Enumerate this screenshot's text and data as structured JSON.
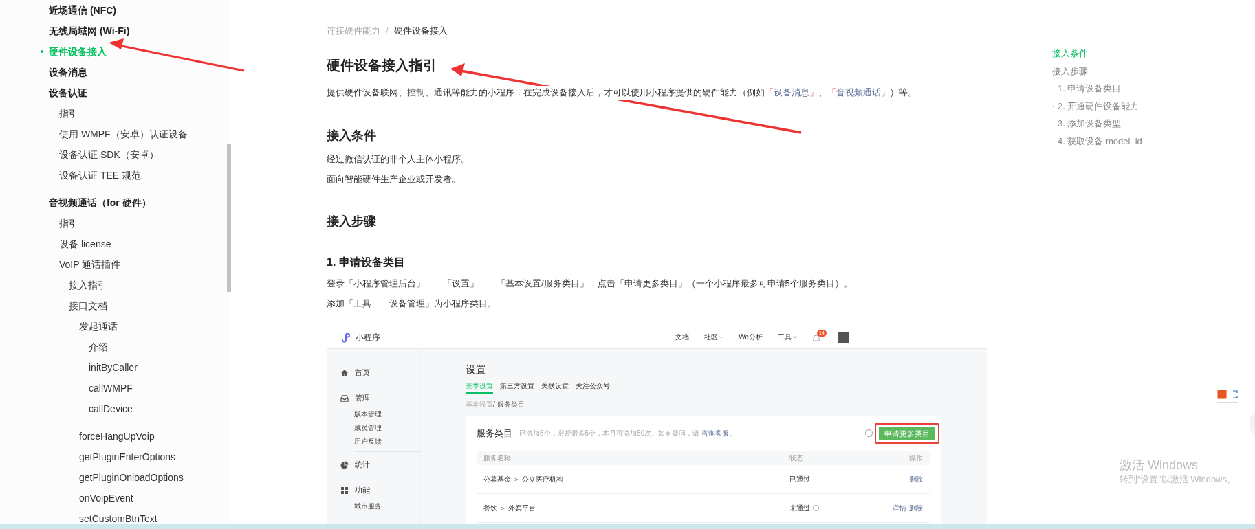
{
  "sidebar": {
    "items": [
      {
        "label": "近场通信 (NFC)",
        "selected": false
      },
      {
        "label": "无线局域网 (Wi-Fi)",
        "selected": false
      },
      {
        "label": "硬件设备接入",
        "selected": true
      },
      {
        "label": "设备消息",
        "selected": false
      },
      {
        "label": "设备认证",
        "selected": false,
        "children": [
          {
            "label": "指引",
            "selected": false
          },
          {
            "label": "使用 WMPF（安卓）认证设备",
            "selected": false
          },
          {
            "label": "设备认证 SDK（安卓）",
            "selected": false
          },
          {
            "label": "设备认证 TEE 规范",
            "selected": false
          }
        ]
      },
      {
        "label": "音视频通话（for 硬件）",
        "selected": false,
        "children": [
          {
            "label": "指引",
            "selected": false
          },
          {
            "label": "设备 license",
            "selected": false
          },
          {
            "label": "VoIP 通话插件",
            "selected": false,
            "children": [
              {
                "label": "接入指引",
                "selected": false
              },
              {
                "label": "接口文档",
                "selected": false,
                "children": [
                  {
                    "label": "发起通话",
                    "selected": false,
                    "children": [
                      {
                        "label": "介绍",
                        "selected": false
                      },
                      {
                        "label": "initByCaller",
                        "selected": false
                      },
                      {
                        "label": "callWMPF",
                        "selected": false
                      },
                      {
                        "label": "callDevice",
                        "selected": false
                      }
                    ]
                  },
                  {
                    "label": "forceHangUpVoip",
                    "selected": false
                  },
                  {
                    "label": "getPluginEnterOptions",
                    "selected": false
                  },
                  {
                    "label": "getPluginOnloadOptions",
                    "selected": false
                  },
                  {
                    "label": "onVoipEvent",
                    "selected": false
                  },
                  {
                    "label": "setCustomBtnText",
                    "selected": false
                  }
                ]
              }
            ]
          }
        ]
      }
    ]
  },
  "breadcrumb": [
    {
      "label": "连接硬件能力",
      "current": false
    },
    {
      "label": "硬件设备接入",
      "current": true
    }
  ],
  "breadcrumb_separator": "/",
  "title": "硬件设备接入指引",
  "intro": [
    {
      "text": "提供硬件设备联网、控制、通讯等能力的小程序，在完成设备接入后，才可以使用小程序提供的硬件能力（例如"
    },
    {
      "text": "「",
      "kind": "bracket"
    },
    {
      "text": "设备消息",
      "kind": "link"
    },
    {
      "text": "」",
      "kind": "bracket"
    },
    {
      "text": "、"
    },
    {
      "text": "「",
      "kind": "bracket"
    },
    {
      "text": "音视频通话",
      "kind": "link"
    },
    {
      "text": "」",
      "kind": "bracket"
    },
    {
      "text": "）等。"
    }
  ],
  "sections": [
    {
      "heading": "接入条件",
      "lines": [
        "经过微信认证的非个人主体小程序。",
        "面向智能硬件生产企业或开发者。"
      ]
    },
    {
      "heading": "接入步骤"
    }
  ],
  "step": {
    "heading": "1. 申请设备类目",
    "lines": [
      "登录「小程序管理后台」——「设置」——「基本设置/服务类目」，点击「申请更多类目」（一个小程序最多可申请5个服务类目）。",
      "添加「工具——设备管理」为小程序类目。"
    ]
  },
  "screenshot": {
    "brand": "小程序",
    "nav": [
      {
        "label": "文档",
        "dropdown": false
      },
      {
        "label": "社区",
        "dropdown": true
      },
      {
        "label": "We分析",
        "dropdown": false
      },
      {
        "label": "工具",
        "dropdown": true
      }
    ],
    "notification_count": "14",
    "menu": [
      {
        "label": "首页"
      },
      {
        "label": "管理",
        "children": [
          "版本管理",
          "成员管理",
          "用户反馈"
        ]
      },
      {
        "label": "统计"
      },
      {
        "label": "功能",
        "children": [
          "城市服务"
        ]
      }
    ],
    "page_title": "设置",
    "tabs": [
      {
        "label": "基本设置",
        "selected": true
      },
      {
        "label": "第三方设置",
        "selected": false
      },
      {
        "label": "关联设置",
        "selected": false
      },
      {
        "label": "关注公众号",
        "selected": false
      }
    ],
    "crumb_parent": "基本设置",
    "crumb_current": "/ 服务类目",
    "card_title": "服务类目",
    "card_note": "已添加5个，常规最多5个，本月可添加50次。如有疑问，请",
    "card_link": "咨询客服。",
    "apply_button": "申请更多类目",
    "columns": [
      "服务名称",
      "状态",
      "操作"
    ],
    "rows": [
      {
        "category": "公募基金 ＞ 公立医疗机构",
        "status": "已通过",
        "help": false,
        "actions": [
          "删除"
        ]
      },
      {
        "category": "餐饮 ＞ 外卖平台",
        "status": "未通过",
        "help": true,
        "actions": [
          "详情",
          "删除"
        ]
      }
    ]
  },
  "toc": [
    {
      "text": "接入条件",
      "selected": true
    },
    {
      "text": "接入步骤",
      "selected": false
    },
    {
      "text": "· 1. 申请设备类目",
      "selected": false
    },
    {
      "text": "· 2. 开通硬件设备能力",
      "selected": false
    },
    {
      "text": "· 3. 添加设备类型",
      "selected": false
    },
    {
      "text": "· 4. 获取设备 model_id",
      "selected": false
    }
  ],
  "os_notice": {
    "title": "激活 Windows",
    "subtitle": "转到“设置”以激活 Windows。"
  }
}
